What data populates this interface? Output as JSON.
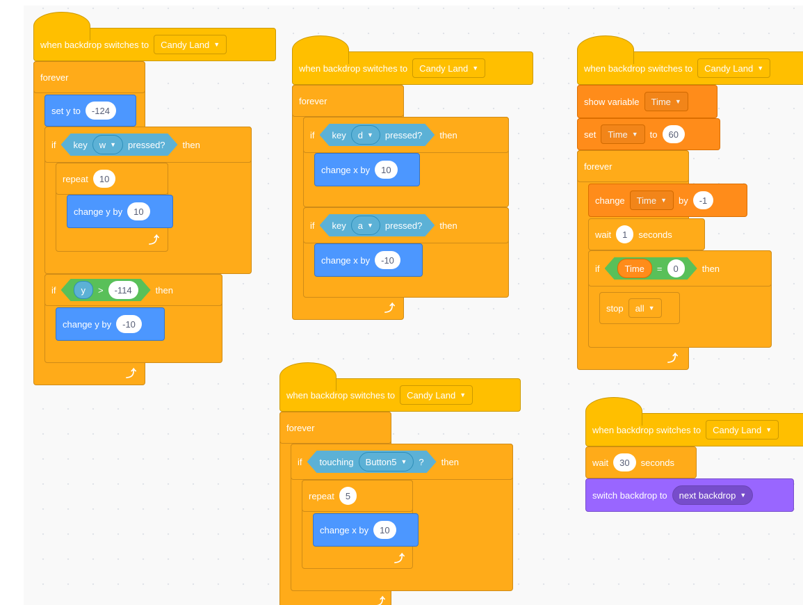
{
  "hat_label": "when backdrop switches to",
  "backdrop": "Candy Land",
  "forever": "forever",
  "if": "if",
  "then": "then",
  "repeat": "repeat",
  "key": "key",
  "pressed": "pressed?",
  "touching": "touching",
  "question": "?",
  "gt": ">",
  "eq": "=",
  "set_y_to": "set y to",
  "change_y_by": "change y by",
  "change_x_by": "change x by",
  "show_variable": "show variable",
  "set": "set",
  "to": "to",
  "change": "change",
  "by": "by",
  "wait": "wait",
  "seconds": "seconds",
  "stop": "stop",
  "all": "all",
  "switch_backdrop_to": "switch backdrop to",
  "next_backdrop": "next backdrop",
  "s1": {
    "set_y": "-124",
    "key_w": "w",
    "repeat_n": "10",
    "change_y_up": "10",
    "y": "y",
    "y_gt": "-114",
    "change_y_down": "-10"
  },
  "s2": {
    "key_d": "d",
    "change_x_right": "10",
    "key_a": "a",
    "change_x_left": "-10"
  },
  "s3": {
    "var": "Time",
    "set_val": "60",
    "change_val": "-1",
    "wait_val": "1",
    "eq_val": "0"
  },
  "s4": {
    "touch_target": "Button5",
    "repeat_n": "5",
    "change_x": "10"
  },
  "s5": {
    "wait_val": "30"
  }
}
